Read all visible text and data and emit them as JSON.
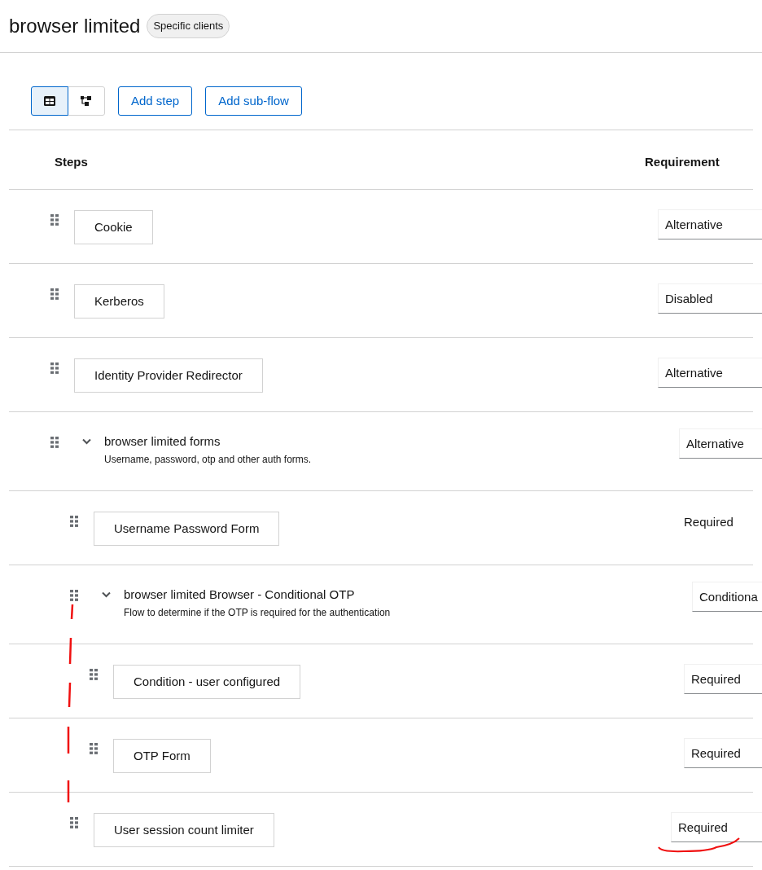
{
  "header": {
    "title": "browser limited",
    "badge": "Specific clients"
  },
  "toolbar": {
    "view_toggle": [
      {
        "kind": "table",
        "selected": true
      },
      {
        "kind": "diagram",
        "selected": false
      }
    ],
    "buttons": [
      "Add step",
      "Add sub-flow"
    ]
  },
  "table": {
    "columns": [
      "Steps",
      "Requirement"
    ],
    "rows": [
      {
        "kind": "step",
        "name": "Cookie",
        "requirement": {
          "kind": "select",
          "text": "Alternative"
        }
      },
      {
        "kind": "step",
        "name": "Kerberos",
        "requirement": {
          "kind": "select",
          "text": "Disabled"
        }
      },
      {
        "kind": "step",
        "name": "Identity Provider Redirector",
        "requirement": {
          "kind": "select",
          "text": "Alternative"
        }
      },
      {
        "kind": "flow",
        "name": "browser limited forms",
        "description": "Username, password, otp and other auth forms.",
        "expanded": true,
        "requirement": {
          "kind": "select",
          "text": "Alternative"
        },
        "children": [
          {
            "kind": "step",
            "name": "Username Password Form",
            "requirement": {
              "kind": "text",
              "text": "Required"
            }
          },
          {
            "kind": "flow",
            "name": "browser limited Browser - Conditional OTP",
            "description": "Flow to determine if the OTP is required for the authentication",
            "expanded": true,
            "requirement": {
              "kind": "select",
              "text": "Conditiona"
            },
            "children": [
              {
                "kind": "step",
                "name": "Condition - user configured",
                "requirement": {
                  "kind": "select",
                  "text": "Required"
                }
              },
              {
                "kind": "step",
                "name": "OTP Form",
                "requirement": {
                  "kind": "select",
                  "text": "Required"
                }
              }
            ]
          },
          {
            "kind": "step",
            "name": "User session count limiter",
            "requirement": {
              "kind": "select",
              "text": "Required"
            }
          }
        ]
      }
    ]
  }
}
